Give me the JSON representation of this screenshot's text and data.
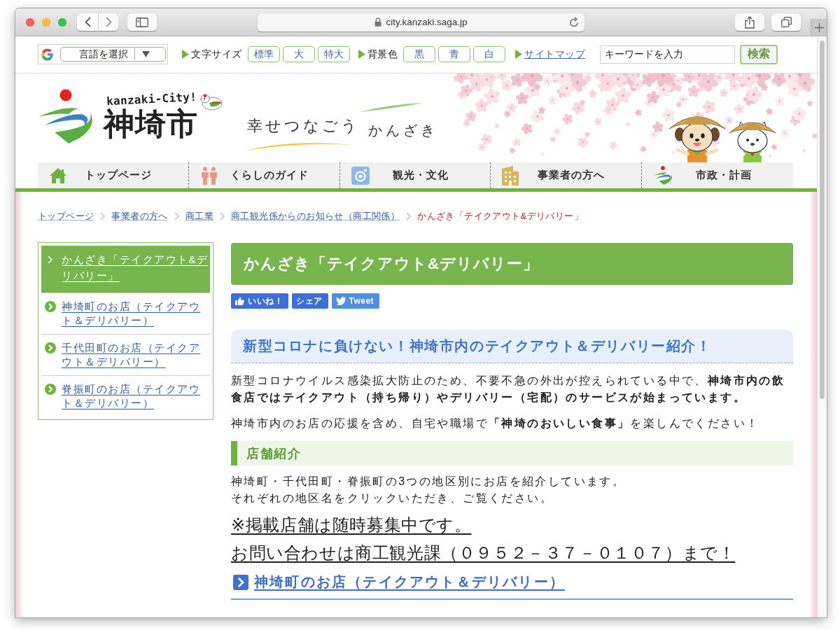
{
  "browser": {
    "url": "city.kanzaki.saga.jp"
  },
  "utility_bar": {
    "language_select": "言語を選択",
    "setting_groups": [
      {
        "label": "文字サイズ",
        "options": [
          "標準",
          "大",
          "特大"
        ]
      },
      {
        "label": "背景色",
        "options": [
          "黒",
          "青",
          "白"
        ]
      }
    ],
    "sitemap_link": "サイトマップ",
    "search": {
      "placeholder": "キーワードを入力",
      "button": "検索"
    }
  },
  "header": {
    "logo": {
      "romaji": "kanzaki-City!",
      "name": "神埼市"
    },
    "tagline": [
      "幸せつなごう",
      "かんざき"
    ]
  },
  "nav": [
    "トップページ",
    "くらしのガイド",
    "観光・文化",
    "事業者の方へ",
    "市政・計画"
  ],
  "breadcrumb": [
    {
      "label": "トップページ",
      "current": false
    },
    {
      "label": "事業者の方へ",
      "current": false
    },
    {
      "label": "商工業",
      "current": false
    },
    {
      "label": "商工観光係からのお知らせ（商工関係）",
      "current": false
    },
    {
      "label": "かんざき「テイクアウト&デリバリー」",
      "current": true
    }
  ],
  "sidebar": [
    {
      "label": "かんざき「テイクアウト&デリバリー」",
      "selected": true
    },
    {
      "label": "神埼町のお店（テイクアウト＆デリバリー）",
      "selected": false
    },
    {
      "label": "千代田町のお店（テイクアウト＆デリバリー）",
      "selected": false
    },
    {
      "label": "脊振町のお店（テイクアウト＆デリバリー）",
      "selected": false
    }
  ],
  "article": {
    "title": "かんざき「テイクアウト&デリバリー」",
    "social_buttons": [
      {
        "kind": "like",
        "label": "いいね！"
      },
      {
        "kind": "share",
        "label": "シェア"
      },
      {
        "kind": "tweet",
        "label": "Tweet"
      }
    ],
    "blocks": [
      {
        "kind": "heading",
        "text": "新型コロナに負けない！神埼市内のテイクアウト＆デリバリー紹介！"
      },
      {
        "kind": "paragraph",
        "lines": [
          "新型コロナウイルス感染拡大防止のため、不要不急の外出が控えられている中で、**神埼市内の飲食店ではテイクアウト（持ち帰り）やデリバリー（宅配）のサービスが始まっています。**"
        ]
      },
      {
        "kind": "paragraph",
        "lines": [
          "神埼市内のお店の応援を含め、自宅や職場で**「神埼のおいしい食事」**を楽しんでください！"
        ]
      },
      {
        "kind": "subheading",
        "text": "店舗紹介"
      },
      {
        "kind": "paragraph",
        "lines": [
          "神埼町・千代田町・脊振町の3つの地区別にお店を紹介しています。",
          "それぞれの地区名をクリックいただき、ご覧ください。"
        ]
      },
      {
        "kind": "notice",
        "text": "※掲載店舗は随時募集中です。"
      },
      {
        "kind": "notice",
        "text": "お問い合わせは商工観光課（０９５２－３７－０１０７）まで！"
      },
      {
        "kind": "link_heading",
        "text": "神埼町のお店（テイクアウト＆デリバリー）"
      }
    ]
  }
}
